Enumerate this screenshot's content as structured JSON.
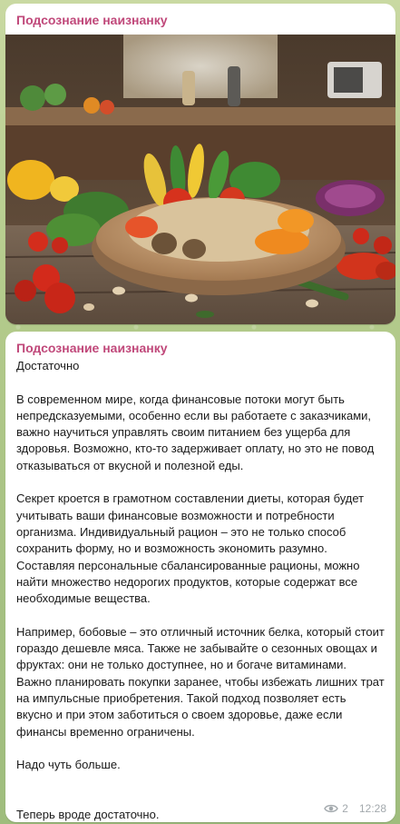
{
  "channel": {
    "name": "Подсознание наизнанку"
  },
  "media_post": {
    "image_icon": "photo-of-vegetables-and-beans"
  },
  "text_post": {
    "paragraphs": [
      "Достаточно",
      "В современном мире, когда финансовые потоки могут быть непредсказуемыми, особенно если вы работаете с заказчиками, важно научиться управлять своим питанием без ущерба для здоровья. Возможно, кто-то задерживает оплату, но это не повод отказываться от вкусной и полезной еды.",
      "Секрет кроется в грамотном составлении диеты, которая будет учитывать ваши финансовые возможности и потребности организма. Индивидуальный рацион – это не только способ сохранить форму, но и возможность экономить разумно. Составляя персональные сбалансированные рационы, можно найти множество недорогих продуктов, которые содержат все необходимые вещества.",
      "Например, бобовые – это отличный источник белка, который стоит гораздо дешевле мяса. Также не забывайте о сезонных овощах и фруктах: они не только доступнее, но и богаче витаминами. Важно планировать покупки заранее, чтобы избежать лишних трат на импульсные приобретения. Такой подход позволяет есть вкусно и при этом заботиться о своем здоровье, даже если финансы временно ограничены.",
      "Надо чуть больше.",
      "Теперь вроде достаточно."
    ],
    "views": "2",
    "time": "12:28"
  },
  "colors": {
    "channel_name": "#c0487a",
    "meta_text": "#a3a9ad",
    "background": "#b4cb8c"
  }
}
